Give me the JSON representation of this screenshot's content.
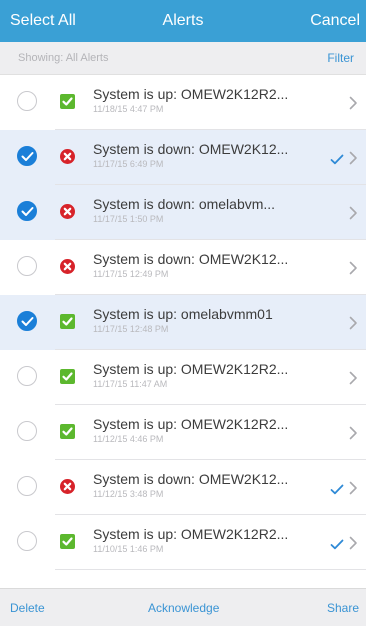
{
  "header": {
    "select_all": "Select All",
    "title": "Alerts",
    "cancel": "Cancel"
  },
  "subheader": {
    "showing": "Showing: All Alerts",
    "filter": "Filter"
  },
  "alerts": [
    {
      "title": "System is up: OMEW2K12R2...",
      "time": "11/18/15 4:47 PM",
      "status": "up",
      "selected": false,
      "acknowledged": false
    },
    {
      "title": "System is down: OMEW2K12...",
      "time": "11/17/15 6:49 PM",
      "status": "down",
      "selected": true,
      "acknowledged": true
    },
    {
      "title": "System is down: omelabvm...",
      "time": "11/17/15 1:50 PM",
      "status": "down",
      "selected": true,
      "acknowledged": false
    },
    {
      "title": "System is down: OMEW2K12...",
      "time": "11/17/15 12:49 PM",
      "status": "down",
      "selected": false,
      "acknowledged": false
    },
    {
      "title": "System is up: omelabvmm01",
      "time": "11/17/15 12:48 PM",
      "status": "up",
      "selected": true,
      "acknowledged": false
    },
    {
      "title": "System is up: OMEW2K12R2...",
      "time": "11/17/15 11:47 AM",
      "status": "up",
      "selected": false,
      "acknowledged": false
    },
    {
      "title": "System is up: OMEW2K12R2...",
      "time": "11/12/15 4:46 PM",
      "status": "up",
      "selected": false,
      "acknowledged": false
    },
    {
      "title": "System is down: OMEW2K12...",
      "time": "11/12/15 3:48 PM",
      "status": "down",
      "selected": false,
      "acknowledged": true
    },
    {
      "title": "System is up: OMEW2K12R2...",
      "time": "11/10/15 1:46 PM",
      "status": "up",
      "selected": false,
      "acknowledged": true
    }
  ],
  "footer": {
    "delete": "Delete",
    "acknowledge": "Acknowledge",
    "share": "Share"
  },
  "colors": {
    "accent": "#3aa0d5",
    "up": "#5cb82e",
    "down": "#d7232a",
    "selected_bg": "#e7eef9",
    "check": "#1b7fd8"
  }
}
